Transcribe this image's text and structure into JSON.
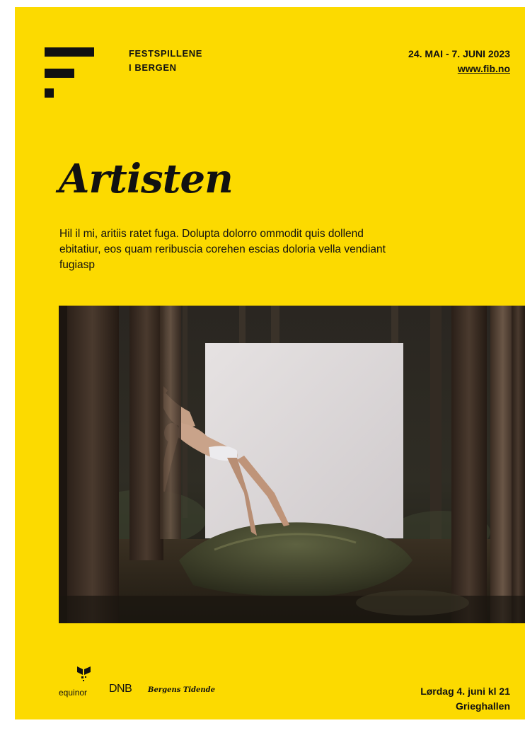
{
  "organization": {
    "line1": "FESTSPILLENE",
    "line2": "I BERGEN"
  },
  "festival": {
    "dates": "24. MAI - 7. JUNI 2023",
    "url": "www.fib.no"
  },
  "performance": {
    "title": "Artisten",
    "description": "Hil il mi, aritiis ratet fuga. Dolupta dolorro ommodit quis dollend ebitatiur, eos quam reribuscia corehen escias doloria vella vendiant fugiasp",
    "date_time": "Lørdag 4. juni kl 21",
    "venue": "Grieghallen"
  },
  "sponsors": {
    "equinor": "equinor",
    "dnb": "DNB",
    "bt": "Bergens Tidende"
  },
  "colors": {
    "background": "#fcda00",
    "ink": "#111111"
  },
  "image": {
    "subject": "dancer-in-forest-with-white-panel"
  }
}
